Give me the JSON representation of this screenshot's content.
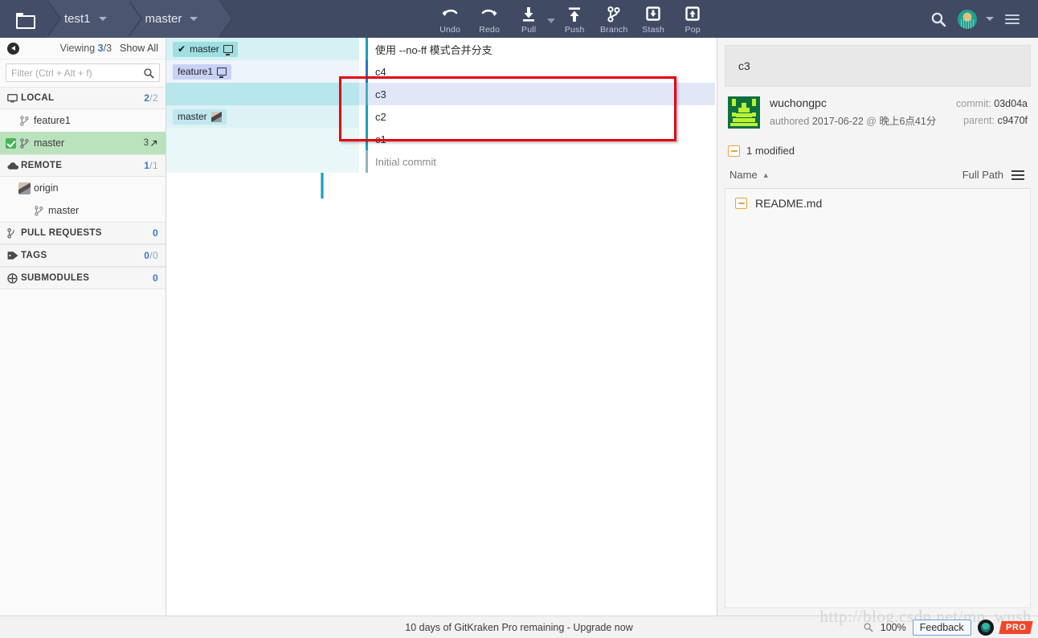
{
  "titlebar": {
    "folder_icon": "folder-icon",
    "repo_name": "test1",
    "branch_name": "master",
    "tools": [
      {
        "id": "undo",
        "label": "Undo",
        "icon": "undo-arrow-icon"
      },
      {
        "id": "redo",
        "label": "Redo",
        "icon": "redo-arrow-icon"
      },
      {
        "id": "pull",
        "label": "Pull",
        "icon": "download-arrow-icon"
      },
      {
        "id": "push",
        "label": "Push",
        "icon": "upload-arrow-icon"
      },
      {
        "id": "branch",
        "label": "Branch",
        "icon": "branch-fork-icon"
      },
      {
        "id": "stash",
        "label": "Stash",
        "icon": "stash-box-down-icon"
      },
      {
        "id": "pop",
        "label": "Pop",
        "icon": "pop-box-up-icon"
      }
    ],
    "search_icon": "search-icon",
    "profile_icon": "user-avatar-icon",
    "menu_icon": "hamburger-menu-icon"
  },
  "sidebar": {
    "back_icon": "back-arrow-icon",
    "viewing_label": "Viewing",
    "viewing_current": "3",
    "viewing_total": "/3",
    "show_all": "Show All",
    "filter_placeholder": "Filter (Ctrl + Alt + f)",
    "filter_value": "",
    "search_icon": "search-icon",
    "sections": [
      {
        "id": "local",
        "label": "LOCAL",
        "icon": "monitor-icon",
        "count": "2",
        "count_total": "/2",
        "items": [
          {
            "id": "feature1",
            "label": "feature1",
            "checked": false,
            "icon": "branch-icon",
            "ahead": ""
          },
          {
            "id": "master",
            "label": "master",
            "checked": true,
            "icon": "branch-icon",
            "ahead": "3"
          }
        ]
      },
      {
        "id": "remote",
        "label": "REMOTE",
        "icon": "cloud-icon",
        "count": "1",
        "count_total": "/1",
        "items": [
          {
            "id": "origin",
            "label": "origin",
            "icon": "remote-avatar-icon"
          },
          {
            "id": "origin-master",
            "label": "master",
            "icon": "branch-icon"
          }
        ]
      },
      {
        "id": "pull-requests",
        "label": "PULL REQUESTS",
        "icon": "pull-request-icon",
        "count": "0",
        "count_total": "",
        "items": []
      },
      {
        "id": "tags",
        "label": "TAGS",
        "icon": "tag-icon",
        "count": "0",
        "count_total": "/0",
        "items": []
      },
      {
        "id": "submodules",
        "label": "SUBMODULES",
        "icon": "submodule-icon",
        "count": "0",
        "count_total": "",
        "items": []
      }
    ]
  },
  "graph": {
    "commits": [
      {
        "id": "c-merge",
        "message": "使用 --no-ff 模式合并分支",
        "refs": [
          {
            "label": "master",
            "type": "current",
            "icon": "monitor-icon",
            "checked": true
          }
        ],
        "node": "merge",
        "selected": false,
        "dim": false
      },
      {
        "id": "c4",
        "message": "c4",
        "refs": [
          {
            "label": "feature1",
            "type": "local",
            "icon": "monitor-icon",
            "checked": false
          }
        ],
        "node": "commit",
        "selected": false,
        "dim": false
      },
      {
        "id": "c3",
        "message": "c3",
        "refs": [],
        "node": "commit",
        "selected": true,
        "dim": false
      },
      {
        "id": "c2",
        "message": "c2",
        "refs": [
          {
            "label": "master",
            "type": "remote",
            "icon": "remote-avatar-icon",
            "checked": false
          }
        ],
        "node": "commit",
        "selected": false,
        "dim": false
      },
      {
        "id": "c1",
        "message": "c1",
        "refs": [],
        "node": "commit",
        "selected": false,
        "dim": false
      },
      {
        "id": "initial",
        "message": "Initial commit",
        "refs": [],
        "node": "initial",
        "selected": false,
        "dim": true
      }
    ],
    "highlight_box": {
      "color": "#e60012"
    }
  },
  "details": {
    "commit_title": "c3",
    "author": "wuchongpc",
    "authored_prefix": "authored",
    "authored_date": "2017-06-22",
    "authored_at": "@",
    "authored_time": "晚上6点41分",
    "commit_label": "commit:",
    "commit_sha": "03d04a",
    "parent_label": "parent:",
    "parent_sha": "c9470f",
    "modified_summary": "1 modified",
    "modified_icon": "file-modified-icon",
    "columns": {
      "name": "Name",
      "sort_icon": "sort-ascending-icon",
      "full_path": "Full Path",
      "list_icon": "list-view-icon"
    },
    "files": [
      {
        "name": "README.md",
        "icon": "file-modified-icon"
      }
    ]
  },
  "statusbar": {
    "message": "10 days of GitKraken Pro remaining - Upgrade now",
    "zoom_icon": "zoom-icon",
    "zoom_level": "100%",
    "feedback": "Feedback",
    "kraken_icon": "gitkraken-logo-icon",
    "pro_badge": "PRO",
    "watermark": "http://blog.csdn.net/mn_wush"
  },
  "colors": {
    "topbar": "#404a63",
    "accent_blue": "#3a78c9",
    "selected_branch": "#b9e2bd",
    "graph_teal": "#17a2b8",
    "graph_blue": "#1565c0",
    "highlight_red": "#e60012",
    "row_selected": "#e2e7f8"
  }
}
